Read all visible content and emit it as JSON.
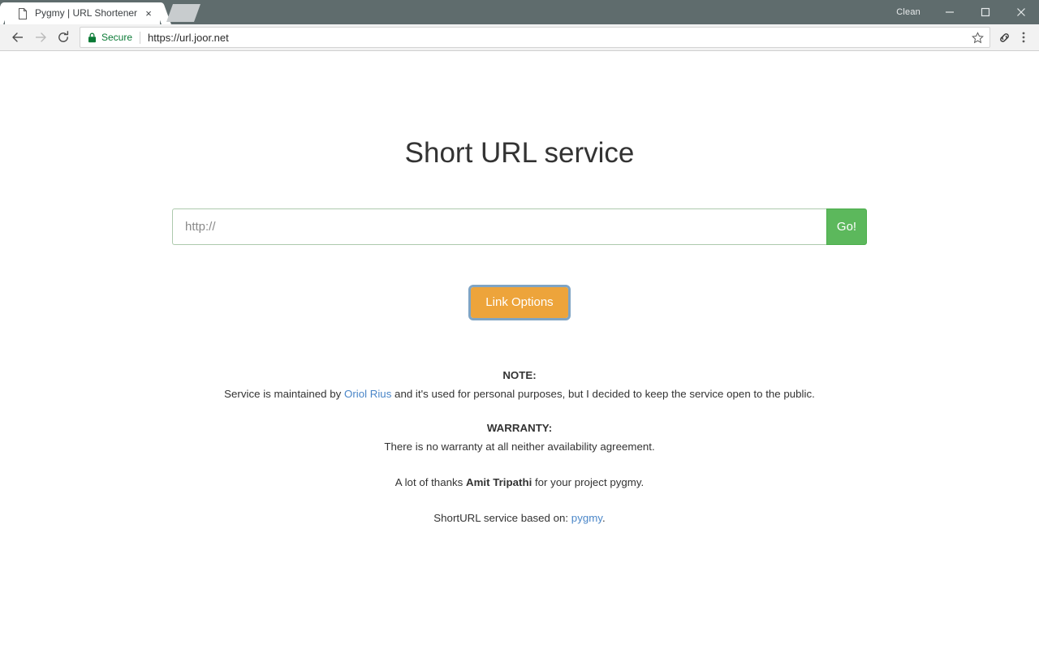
{
  "browser": {
    "tab": {
      "title": "Pygmy | URL Shortener",
      "close_label": "×",
      "favicon_name": "page-icon"
    },
    "new_tab_label": "",
    "window": {
      "profile_label": "Clean",
      "minimize_label": "—",
      "maximize_label": "☐",
      "close_label": "✕"
    },
    "toolbar": {
      "back_label": "←",
      "forward_label": "→",
      "reload_label": "↻",
      "security_text": "Secure",
      "url": "https://url.joor.net",
      "bookmark_label": "☆",
      "extension_label": "🔗",
      "menu_label": "⋮"
    }
  },
  "page": {
    "heading": "Short URL service",
    "form": {
      "input_value": "",
      "input_placeholder": "http://",
      "submit_label": "Go!"
    },
    "link_options_label": "Link Options",
    "notes": {
      "note_heading": "NOTE:",
      "note_text_before": "Service is maintained by ",
      "note_link": "Oriol Rius",
      "note_text_after": " and it's used for personal purposes, but I decided to keep the service open to the public.",
      "warranty_heading": "WARRANTY:",
      "warranty_text": "There is no warranty at all neither availability agreement.",
      "thanks_before": "A lot of thanks ",
      "thanks_name": "Amit Tripathi",
      "thanks_after": " for your project pygmy.",
      "based_before": "ShortURL service based on: ",
      "based_link": "pygmy",
      "based_after": "."
    }
  },
  "colors": {
    "chrome_titlebar": "#5f6c6d",
    "go_button": "#5cb85c",
    "link_options_button": "#eda43b",
    "link_blue": "#4a86c8",
    "secure_green": "#0b7a36",
    "input_border": "#adc9ad"
  }
}
